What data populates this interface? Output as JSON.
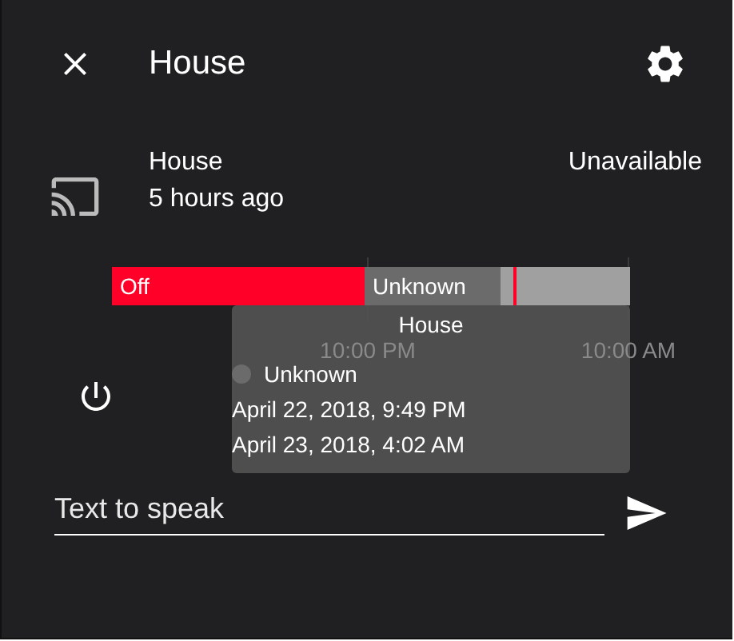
{
  "dialog": {
    "title": "House"
  },
  "entity": {
    "name": "House",
    "last_changed": "5 hours ago",
    "state": "Unavailable"
  },
  "history": {
    "timeline": {
      "segment_labels": [
        "Off",
        "Unknown"
      ],
      "axis_labels": [
        "10:00 PM",
        "10:00 AM"
      ]
    },
    "tooltip": {
      "title": "House",
      "state": "Unknown",
      "start": "April 22, 2018, 9:49 PM",
      "end": "April 23, 2018, 4:02 AM"
    }
  },
  "tts": {
    "placeholder": "Text to speak"
  }
}
